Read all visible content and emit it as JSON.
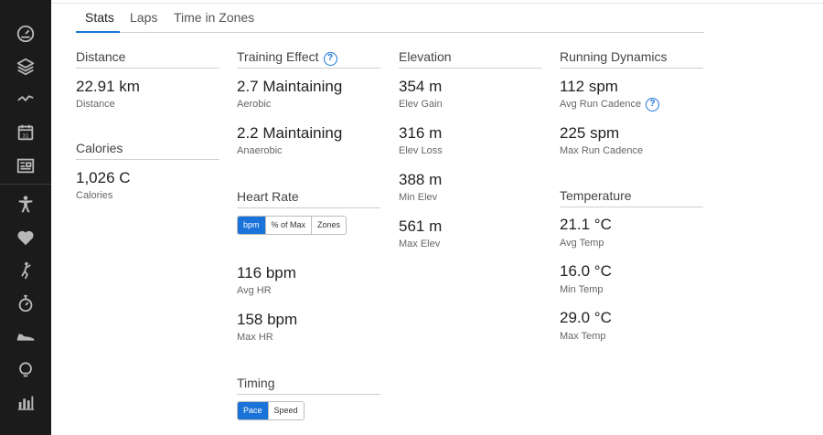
{
  "tabs": [
    {
      "label": "Stats"
    },
    {
      "label": "Laps"
    },
    {
      "label": "Time in Zones"
    }
  ],
  "sidebar": {
    "icons": [
      "dashboard-gauge-icon",
      "layers-icon",
      "activity-pulse-icon",
      "calendar-icon",
      "news-icon",
      "person-fitness-icon",
      "heart-icon",
      "golf-icon",
      "stopwatch-icon",
      "shoe-icon",
      "lightbulb-icon",
      "bar-chart-icon"
    ]
  },
  "distance": {
    "heading": "Distance",
    "value": "22.91 km",
    "label": "Distance"
  },
  "calories": {
    "heading": "Calories",
    "value": "1,026 C",
    "label": "Calories"
  },
  "training_effect": {
    "heading": "Training Effect",
    "help": "?",
    "aerobic_value": "2.7 Maintaining",
    "aerobic_label": "Aerobic",
    "anaerobic_value": "2.2 Maintaining",
    "anaerobic_label": "Anaerobic"
  },
  "heart_rate": {
    "heading": "Heart Rate",
    "options": [
      "bpm",
      "% of Max",
      "Zones"
    ],
    "selected": "bpm",
    "avg_value": "116 bpm",
    "avg_label": "Avg HR",
    "max_value": "158 bpm",
    "max_label": "Max HR"
  },
  "timing": {
    "heading": "Timing",
    "options": [
      "Pace",
      "Speed"
    ],
    "selected": "Pace"
  },
  "elevation": {
    "heading": "Elevation",
    "gain_value": "354 m",
    "gain_label": "Elev Gain",
    "loss_value": "316 m",
    "loss_label": "Elev Loss",
    "min_value": "388 m",
    "min_label": "Min Elev",
    "max_value": "561 m",
    "max_label": "Max Elev"
  },
  "running_dynamics": {
    "heading": "Running Dynamics",
    "avg_cadence_value": "112 spm",
    "avg_cadence_label": "Avg Run Cadence",
    "help": "?",
    "max_cadence_value": "225 spm",
    "max_cadence_label": "Max Run Cadence"
  },
  "temperature": {
    "heading": "Temperature",
    "avg_value": "21.1 °C",
    "avg_label": "Avg Temp",
    "min_value": "16.0 °C",
    "min_label": "Min Temp",
    "max_value": "29.0 °C",
    "max_label": "Max Temp"
  },
  "colors": {
    "accent": "#1a73d9",
    "sidebar_bg": "#1b1b1b",
    "sidebar_icon": "#b8b8b8"
  }
}
